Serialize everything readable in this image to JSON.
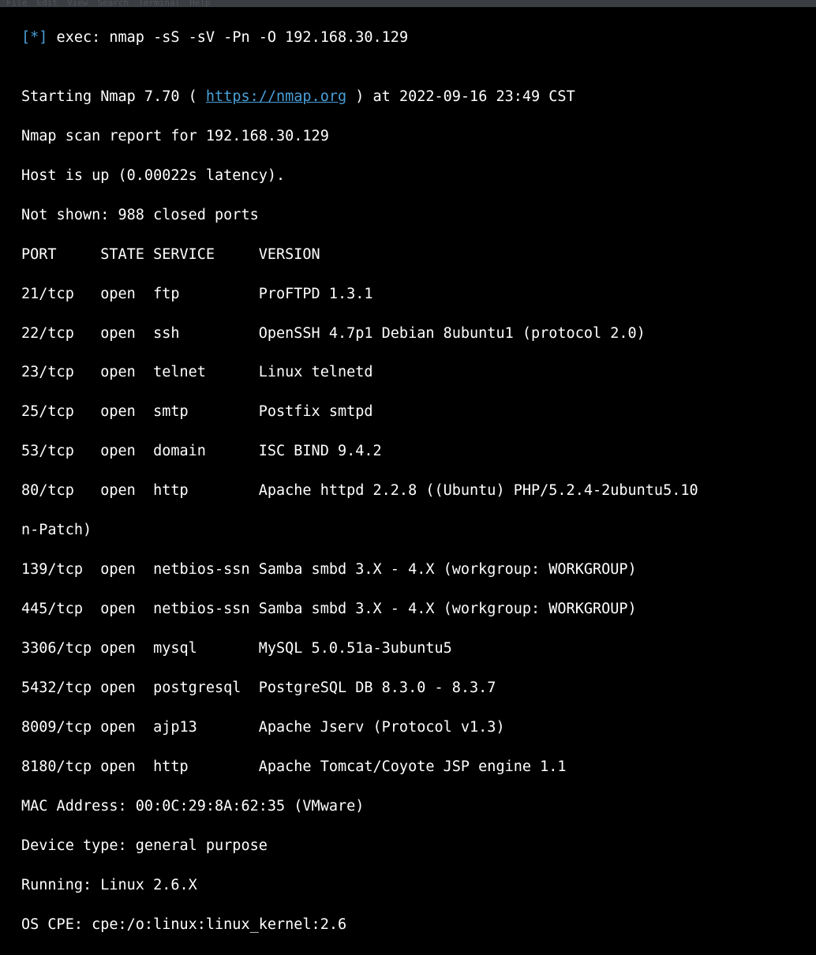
{
  "menu": {
    "items": [
      "File",
      "Edit",
      "View",
      "Search",
      "Terminal",
      "Help"
    ]
  },
  "prompt": {
    "open_bracket": "[",
    "star": "*",
    "close_bracket": "]",
    "exec_label": " exec: ",
    "command": "nmap -sS -sV -Pn -O 192.168.30.129"
  },
  "output": {
    "blank1": "",
    "start_line_pre": "Starting Nmap 7.70 ( ",
    "start_line_url": "https://nmap.org",
    "start_line_post": " ) at 2022-09-16 23:49 CST",
    "scan_report": "Nmap scan report for 192.168.30.129",
    "host_up": "Host is up (0.00022s latency).",
    "not_shown": "Not shown: 988 closed ports",
    "header": "PORT     STATE SERVICE     VERSION",
    "rows": [
      "21/tcp   open  ftp         ProFTPD 1.3.1",
      "22/tcp   open  ssh         OpenSSH 4.7p1 Debian 8ubuntu1 (protocol 2.0)",
      "23/tcp   open  telnet      Linux telnetd",
      "25/tcp   open  smtp        Postfix smtpd",
      "53/tcp   open  domain      ISC BIND 9.4.2",
      "80/tcp   open  http        Apache httpd 2.2.8 ((Ubuntu) PHP/5.2.4-2ubuntu5.10",
      "n-Patch)",
      "139/tcp  open  netbios-ssn Samba smbd 3.X - 4.X (workgroup: WORKGROUP)",
      "445/tcp  open  netbios-ssn Samba smbd 3.X - 4.X (workgroup: WORKGROUP)",
      "3306/tcp open  mysql       MySQL 5.0.51a-3ubuntu5",
      "5432/tcp open  postgresql  PostgreSQL DB 8.3.0 - 8.3.7",
      "8009/tcp open  ajp13       Apache Jserv (Protocol v1.3)",
      "8180/tcp open  http        Apache Tomcat/Coyote JSP engine 1.1"
    ],
    "mac": "MAC Address: 00:0C:29:8A:62:35 (VMware)",
    "device_type": "Device type: general purpose",
    "running": "Running: Linux 2.6.X",
    "os_cpe": "OS CPE: cpe:/o:linux:linux_kernel:2.6"
  }
}
